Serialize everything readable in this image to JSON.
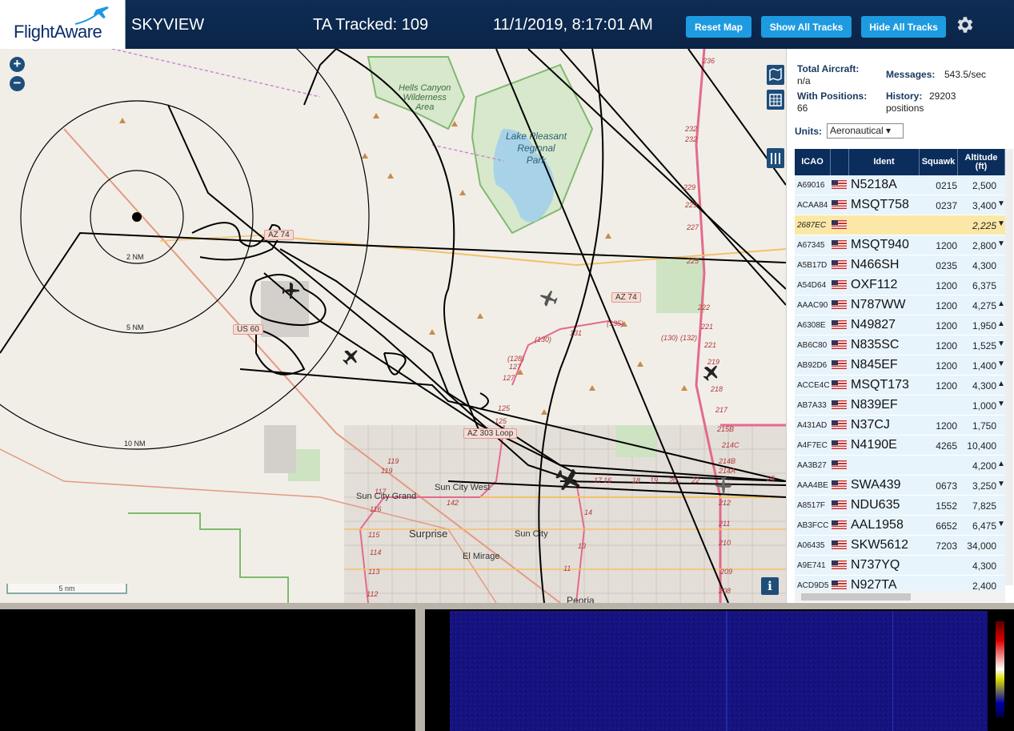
{
  "header": {
    "logo_text": "FlightAware",
    "app_title": "SKYVIEW",
    "tracked": "TA Tracked: 109",
    "datetime": "11/1/2019, 8:17:01 AM",
    "buttons": {
      "reset": "Reset Map",
      "show_all": "Show All Tracks",
      "hide_all": "Hide All Tracks"
    }
  },
  "map": {
    "zoom_in": "+",
    "zoom_out": "−",
    "scale": "5 nm",
    "info": "i",
    "rings": [
      "2 NM",
      "5 NM",
      "10 NM"
    ],
    "places": {
      "sun_city_west": "Sun City West",
      "sun_city_grand": "Sun City Grand",
      "surprise": "Surprise",
      "sun_city": "Sun City",
      "el_mirage": "El Mirage",
      "peoria": "Peoria"
    },
    "parks": {
      "hells_canyon": "Hells Canyon\nWilderness\nArea",
      "lake_pleasant": "Lake Pleasant\nRegional\nPark"
    },
    "roads": {
      "az74_a": "AZ 74",
      "az74_b": "AZ 74",
      "us60": "US 60",
      "az303": "AZ 303 Loop"
    },
    "mile_markers": [
      "236",
      "232",
      "232",
      "229",
      "229",
      "227",
      "225",
      "222",
      "221",
      "221",
      "219",
      "218",
      "217",
      "215B",
      "214C",
      "214B",
      "214A",
      "212",
      "211",
      "210",
      "209",
      "208",
      "131",
      "(130)",
      "(135)",
      "(128)",
      "127",
      "127",
      "125",
      "125",
      "119",
      "119",
      "117",
      "116",
      "115",
      "114",
      "113",
      "112",
      "142",
      "17",
      "16",
      "18",
      "19",
      "20",
      "22",
      "14",
      "13",
      "11",
      "(130)",
      "(132)",
      "25"
    ]
  },
  "panel": {
    "total_aircraft_label": "Total Aircraft:",
    "total_aircraft_value": "n/a",
    "with_positions_label": "With Positions:",
    "with_positions_value": "66",
    "messages_label": "Messages:",
    "messages_value": "543.5/sec",
    "history_label": "History:",
    "history_value": "29203",
    "history_unit": "positions",
    "units_label": "Units:",
    "units_value": "Aeronautical ▾",
    "columns": {
      "icao": "ICAO",
      "ident": "Ident",
      "squawk": "Squawk",
      "altitude": "Altitude\n(ft)"
    },
    "rows": [
      {
        "icao": "A69016",
        "ident": "N5218A",
        "squawk": "0215",
        "alt": "2,500",
        "arrow": ""
      },
      {
        "icao": "ACAA84",
        "ident": "MSQT758",
        "squawk": "0237",
        "alt": "3,400",
        "arrow": "▼"
      },
      {
        "icao": "2687EC",
        "ident": "",
        "squawk": "",
        "alt": "2,225",
        "arrow": "▼"
      },
      {
        "icao": "A67345",
        "ident": "MSQT940",
        "squawk": "1200",
        "alt": "2,800",
        "arrow": "▼"
      },
      {
        "icao": "A5B17D",
        "ident": "N466SH",
        "squawk": "0235",
        "alt": "4,300",
        "arrow": ""
      },
      {
        "icao": "A54D64",
        "ident": "OXF112",
        "squawk": "1200",
        "alt": "6,375",
        "arrow": ""
      },
      {
        "icao": "AAAC90",
        "ident": "N787WW",
        "squawk": "1200",
        "alt": "4,275",
        "arrow": "▲"
      },
      {
        "icao": "A6308E",
        "ident": "N49827",
        "squawk": "1200",
        "alt": "1,950",
        "arrow": "▲"
      },
      {
        "icao": "AB6C80",
        "ident": "N835SC",
        "squawk": "1200",
        "alt": "1,525",
        "arrow": "▼"
      },
      {
        "icao": "AB92D6",
        "ident": "N845EF",
        "squawk": "1200",
        "alt": "1,400",
        "arrow": "▼"
      },
      {
        "icao": "ACCE4C",
        "ident": "MSQT173",
        "squawk": "1200",
        "alt": "4,300",
        "arrow": "▲"
      },
      {
        "icao": "AB7A33",
        "ident": "N839EF",
        "squawk": "",
        "alt": "1,000",
        "arrow": "▼"
      },
      {
        "icao": "A431AD",
        "ident": "N37CJ",
        "squawk": "1200",
        "alt": "1,750",
        "arrow": ""
      },
      {
        "icao": "A4F7EC",
        "ident": "N4190E",
        "squawk": "4265",
        "alt": "10,400",
        "arrow": ""
      },
      {
        "icao": "AA3B27",
        "ident": "",
        "squawk": "",
        "alt": "4,200",
        "arrow": "▲"
      },
      {
        "icao": "AAA4BE",
        "ident": "SWA439",
        "squawk": "0673",
        "alt": "3,250",
        "arrow": "▼"
      },
      {
        "icao": "A8517F",
        "ident": "NDU635",
        "squawk": "1552",
        "alt": "7,825",
        "arrow": ""
      },
      {
        "icao": "AB3FCC",
        "ident": "AAL1958",
        "squawk": "6652",
        "alt": "6,475",
        "arrow": "▼"
      },
      {
        "icao": "A06435",
        "ident": "SKW5612",
        "squawk": "7203",
        "alt": "34,000",
        "arrow": ""
      },
      {
        "icao": "A9E741",
        "ident": "N737YQ",
        "squawk": "",
        "alt": "4,300",
        "arrow": ""
      },
      {
        "icao": "ACD9D5",
        "ident": "N927TA",
        "squawk": "",
        "alt": "2,400",
        "arrow": ""
      }
    ]
  }
}
